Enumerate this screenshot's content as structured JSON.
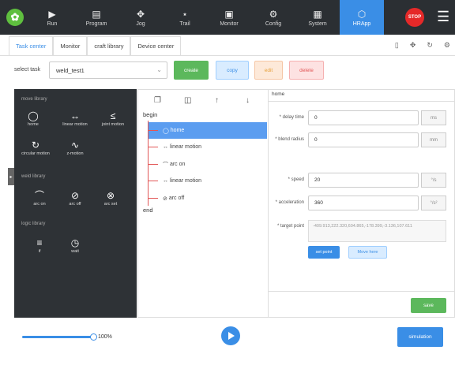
{
  "topnav": {
    "items": [
      {
        "label": "Run",
        "icon": "play-screen-icon"
      },
      {
        "label": "Program",
        "icon": "program-icon"
      },
      {
        "label": "Jog",
        "icon": "jog-icon"
      },
      {
        "label": "Trail",
        "icon": "trail-icon"
      },
      {
        "label": "Monitor",
        "icon": "monitor-icon"
      },
      {
        "label": "Config",
        "icon": "gear-icon"
      },
      {
        "label": "System",
        "icon": "system-icon"
      },
      {
        "label": "HRApp",
        "icon": "cube-icon"
      }
    ],
    "stop_label": "STOP"
  },
  "tabs": [
    "Task center",
    "Monitor",
    "craft library",
    "Device center"
  ],
  "task": {
    "select_label": "select task",
    "selected_value": "weld_test1",
    "create": "create",
    "copy": "copy",
    "edit": "edit",
    "delete": "delete"
  },
  "library": {
    "move_title": "move library",
    "move_items": [
      "home",
      "linear motion",
      "joint motion",
      "circular motion",
      "z-motion"
    ],
    "weld_title": "weld library",
    "weld_items": [
      "arc on",
      "arc off",
      "arc set"
    ],
    "logic_title": "logic library",
    "logic_items": [
      "if",
      "wait"
    ]
  },
  "program": {
    "begin": "begin",
    "end": "end",
    "nodes": [
      "home",
      "linear motion",
      "arc on",
      "linear motion",
      "arc off"
    ]
  },
  "props": {
    "header": "home",
    "delay_label": "* delay time",
    "delay_value": "0",
    "delay_unit": "ms",
    "blend_label": "* blend radius",
    "blend_value": "0",
    "blend_unit": "mm",
    "speed_label": "* speed",
    "speed_value": "20",
    "speed_unit": "°/s",
    "acc_label": "* acceleration",
    "acc_value": "360",
    "acc_unit": "°/s²",
    "target_label": "* target point",
    "target_value": "-409.913,222.320,604.865,-178.399,-3.136,107.611",
    "set_point": "set point",
    "move_here": "Move here",
    "save": "save"
  },
  "bottom": {
    "speed_percent": "100%",
    "speed_value": 1.0,
    "simulation": "simulation"
  }
}
